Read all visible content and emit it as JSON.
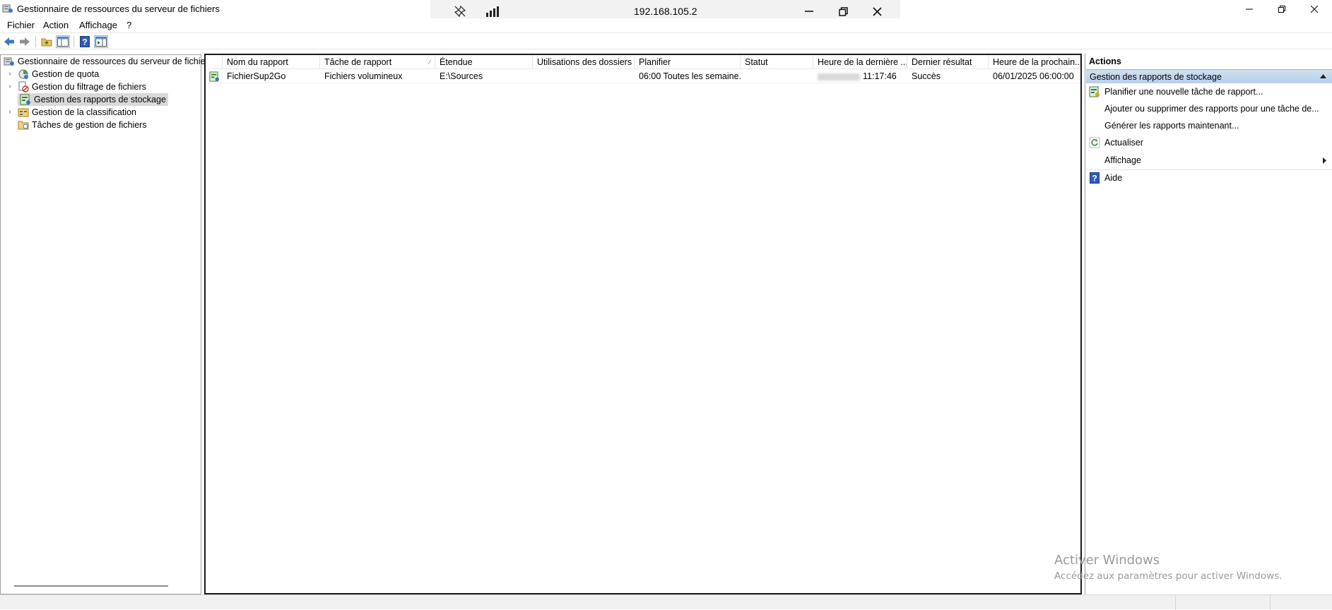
{
  "window": {
    "title": "Gestionnaire de ressources du serveur de fichiers"
  },
  "remote_bar": {
    "ip": "192.168.105.2"
  },
  "menu": {
    "items": [
      "Fichier",
      "Action",
      "Affichage",
      "?"
    ]
  },
  "tree": {
    "root": "Gestionnaire de ressources du serveur de fichiers",
    "items": [
      {
        "label": "Gestion de quota",
        "expandable": true
      },
      {
        "label": "Gestion du filtrage de fichiers",
        "expandable": true
      },
      {
        "label": "Gestion des rapports de stockage",
        "expandable": false,
        "selected": true
      },
      {
        "label": "Gestion de la classification",
        "expandable": true
      },
      {
        "label": "Tâches de gestion de fichiers",
        "expandable": false
      }
    ]
  },
  "table": {
    "columns": [
      "Nom du rapport",
      "Tâche de rapport",
      "Étendue",
      "Utilisations des dossiers",
      "Planifier",
      "Statut",
      "Heure de la dernière ...",
      "Dernier résultat",
      "Heure de la prochain..."
    ],
    "rows": [
      {
        "name": "FichierSup2Go",
        "task": "Fichiers volumineux",
        "scope": "E:\\Sources",
        "folder_usage": "",
        "schedule": "06:00 Toutes les semaine...",
        "status": "",
        "last_run_time": "11:17:46",
        "last_result": "Succès",
        "next_run_time": "06/01/2025 06:00:00"
      }
    ]
  },
  "actions": {
    "title": "Actions",
    "section": "Gestion des rapports de stockage",
    "items": [
      {
        "label": "Planifier une nouvelle tâche de rapport...",
        "icon": "new-report-task-icon"
      },
      {
        "label": "Ajouter ou supprimer des rapports pour une tâche de...",
        "icon": ""
      },
      {
        "label": "Générer les rapports maintenant...",
        "icon": ""
      },
      {
        "label": "Actualiser",
        "icon": "refresh-icon"
      },
      {
        "label": "Affichage",
        "icon": "",
        "submenu": true
      },
      {
        "label": "Aide",
        "icon": "help-icon"
      }
    ]
  },
  "watermark": {
    "line1": "Activer Windows",
    "line2": "Accédez aux paramètres pour activer Windows."
  },
  "colors": {
    "selection": "#d9d9d9",
    "section_header": "#c4d8ee",
    "watermark": "#9a9a9a"
  }
}
